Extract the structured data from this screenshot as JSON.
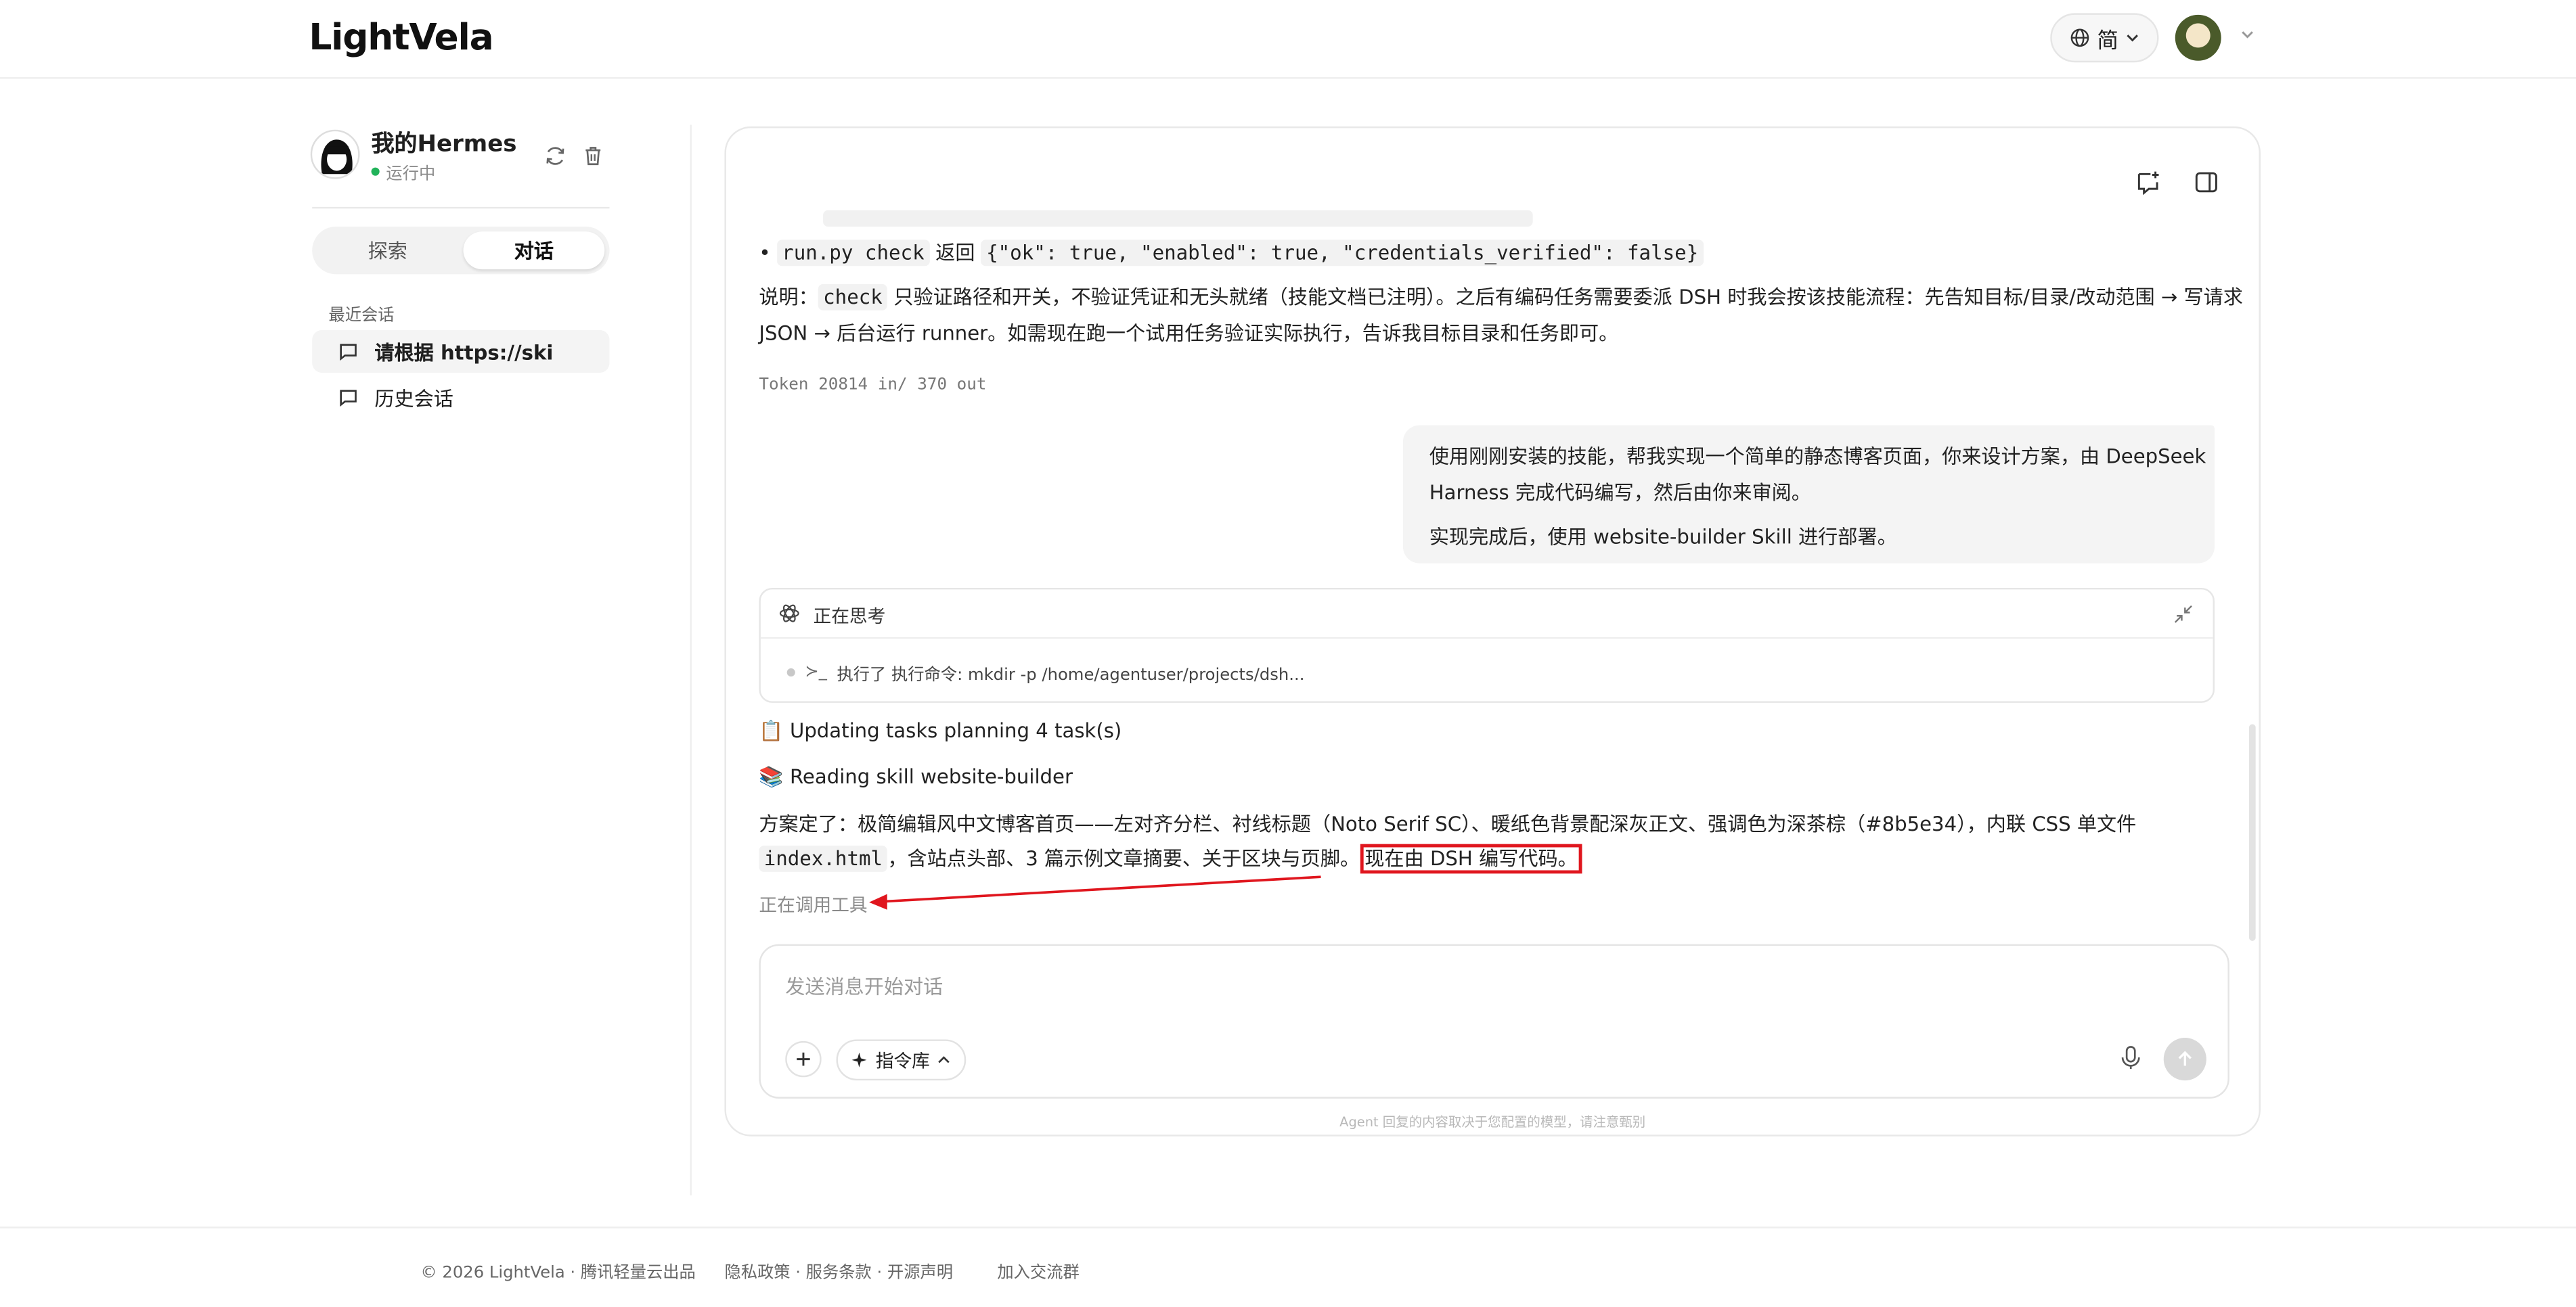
{
  "app": {
    "logo": "LightVela"
  },
  "header": {
    "lang_label": "简"
  },
  "sidebar": {
    "agent_name": "我的Hermes",
    "agent_status": "运行中",
    "tabs": [
      {
        "label": "探索"
      },
      {
        "label": "对话"
      }
    ],
    "recent_label": "最近会话",
    "conversations": [
      {
        "label": "请根据 https://ski"
      },
      {
        "label": "历史会话"
      }
    ]
  },
  "chat": {
    "bullet_prefix": "•",
    "bullet_cmd": "run.py check",
    "bullet_mid": "返回",
    "bullet_json": "{\"ok\": true, \"enabled\": true, \"credentials_verified\": false}",
    "note_prefix": "说明：",
    "note_code": "check",
    "note_rest_line1": "只验证路径和开关，不验证凭证和无头就绪（技能文档已注明）。之后有编码任务需要委派 DSH 时我会按该技能流程：先告知目标/目录/改动范围 → 写请求",
    "note_line2": "JSON → 后台运行 runner。如需现在跑一个试用任务验证实际执行，告诉我目标目录和任务即可。",
    "token": "Token 20814 in/ 370 out",
    "user_line1": "使用刚刚安装的技能，帮我实现一个简单的静态博客页面，你来设计方案，由 DeepSeek",
    "user_line2": "Harness 完成代码编写，然后由你来审阅。",
    "user_line3": "实现完成后，使用 website-builder Skill 进行部署。",
    "thinking_title": "正在思考",
    "thinking_row": "执行了 执行命令: mkdir -p /home/agentuser/projects/dsh...",
    "thinking_prompt_glyph": "≻_",
    "step1_icon": "📋",
    "step1": "Updating tasks planning 4 task(s)",
    "step2_icon": "📚",
    "step2": "Reading skill website-builder",
    "plan_line1": "方案定了：极简编辑风中文博客首页——左对齐分栏、衬线标题（Noto Serif SC）、暖纸色背景配深灰正文、强调色为深茶棕（#8b5e34），内联 CSS 单文件",
    "plan_code": "index.html",
    "plan_line2_rest": "，含站点头部、3 篇示例文章摘要、关于区块与页脚。",
    "plan_highlight": "现在由 DSH 编写代码。",
    "calling_tool": "正在调用工具",
    "input_placeholder": "发送消息开始对话",
    "command_library": "指令库",
    "disclaimer": "Agent 回复的内容取决于您配置的模型，请注意甄别"
  },
  "footer": {
    "copyright": "© 2026 LightVela · 腾讯轻量云出品",
    "legal": "隐私政策 · 服务条款 · 开源声明",
    "community": "加入交流群"
  },
  "colors": {
    "status_green": "#21b35a",
    "annotation_red": "#e0161e"
  }
}
